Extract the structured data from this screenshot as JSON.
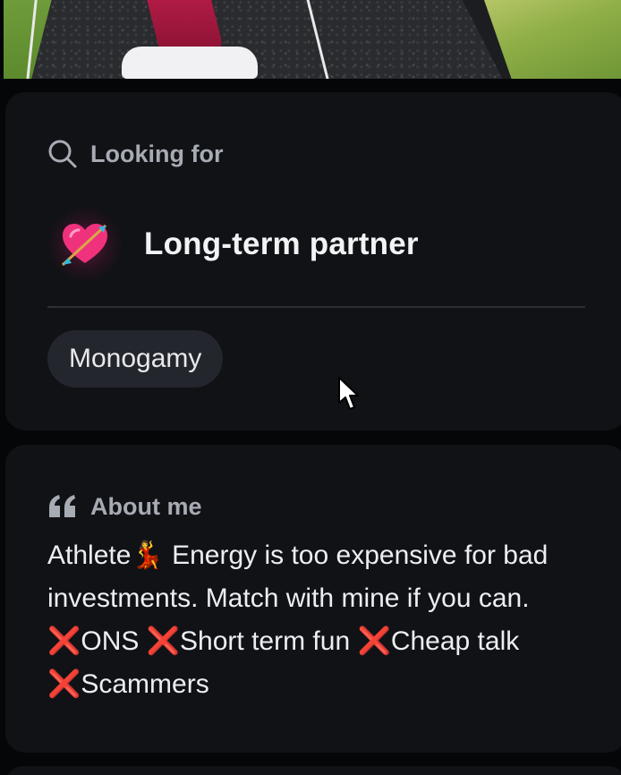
{
  "looking_for": {
    "heading": "Looking for",
    "goal": {
      "emoji": "💘",
      "title": "Long-term partner"
    },
    "tags": [
      "Monogamy"
    ]
  },
  "about_me": {
    "heading": "About me",
    "bio": "Athlete💃 Energy is too expensive for bad investments. Match with mine if you can. ❌ONS ❌Short term fun ❌Cheap talk ❌Scammers"
  },
  "icons": {
    "looking_for": "search-icon",
    "about_me": "quote-icon",
    "pointer": "mouse-pointer-icon"
  },
  "colors": {
    "background": "#050608",
    "card": "#101216",
    "heading_text": "#a7abb3",
    "primary_text": "#f2f3f5",
    "chip_bg": "#23262d",
    "divider": "#2b2f36",
    "emoji_glow": "#e12878"
  }
}
